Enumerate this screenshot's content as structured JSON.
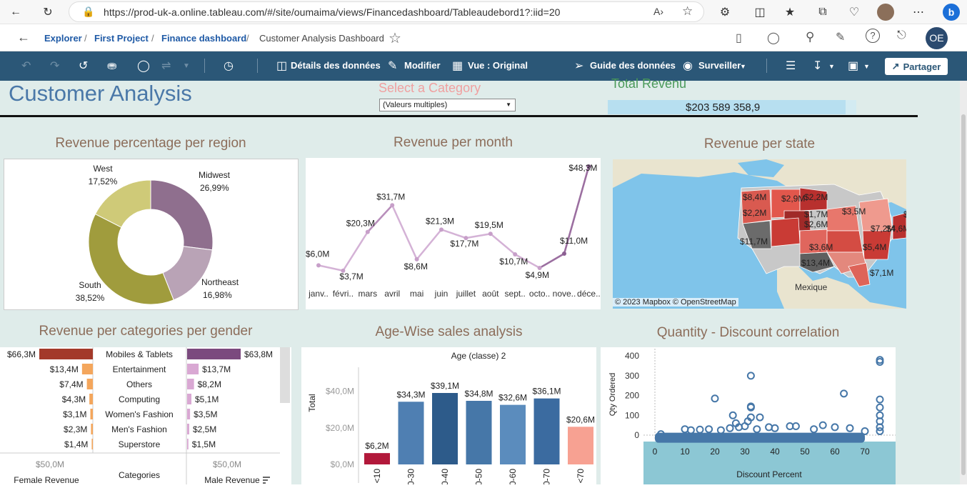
{
  "browser": {
    "url": "https://prod-uk-a.online.tableau.com/#/site/oumaima/views/Financedashboard/Tableaudebord1?:iid=20"
  },
  "breadcrumb": {
    "items": [
      "Explorer",
      "First Project",
      "Finance dashboard"
    ],
    "current": "Customer Analysis Dashboard"
  },
  "user": {
    "initials": "OE"
  },
  "toolbar": {
    "data_details": "Détails des données",
    "modify": "Modifier",
    "view": "Vue : Original",
    "data_guide": "Guide des données",
    "watch": "Surveiller",
    "share": "Partager"
  },
  "dashboard": {
    "title": "Customer Analysis",
    "category_filter": {
      "label": "Select a Category",
      "value": "(Valeurs multiples)"
    },
    "total_revenue": {
      "label": "Total Revenu",
      "value": "$203 589 358,9"
    }
  },
  "colors": {
    "toolbar": "#2b5777",
    "dashboard_bg": "#dfecea",
    "title_blue": "#4a78a8",
    "chart_title": "#8c6d5a",
    "filter_label": "#f0a0a0",
    "revenue_label": "#4a9a5a"
  },
  "region_chart": {
    "title": "Revenue percentage per region",
    "slices": [
      {
        "region": "Midwest",
        "pct": 26.99,
        "label": "26,99%",
        "color": "#8f6f8e"
      },
      {
        "region": "Northeast",
        "pct": 16.98,
        "label": "16,98%",
        "color": "#b9a3b6"
      },
      {
        "region": "South",
        "pct": 38.52,
        "label": "38,52%",
        "color": "#a09c3d"
      },
      {
        "region": "West",
        "pct": 17.52,
        "label": "17,52%",
        "color": "#cfca78"
      }
    ]
  },
  "month_chart": {
    "title": "Revenue per month",
    "months": [
      "janv..",
      "févri..",
      "mars",
      "avril",
      "mai",
      "juin",
      "juillet",
      "août",
      "sept..",
      "octo..",
      "nove..",
      "déce.."
    ],
    "values": [
      6.0,
      3.7,
      20.3,
      31.7,
      8.6,
      21.3,
      17.7,
      19.5,
      10.7,
      4.9,
      11.0,
      48.3
    ],
    "labels": [
      "$6,0M",
      "$3,7M",
      "$20,3M",
      "$31,7M",
      "$8,6M",
      "$21,3M",
      "$17,7M",
      "$19,5M",
      "$10,7M",
      "$4,9M",
      "$11,0M",
      "$48,3M"
    ]
  },
  "state_map": {
    "title": "Revenue per state",
    "labels": [
      "$8,4M",
      "$2,9M",
      "$2,2M",
      "$2,2M",
      "$1,7M",
      "$3,5M",
      "$2,6M",
      "$7,2M",
      "$4,6M",
      "$1,1",
      "$11,7M",
      "$3,6M",
      "$13,4M",
      "$5,4M",
      "$7,1M"
    ],
    "country_label": "Mexique",
    "attribution": "© 2023 Mapbox  © OpenStreetMap"
  },
  "gender_chart": {
    "title": "Revenue per categories per gender",
    "categories": [
      "Mobiles & Tablets",
      "Entertainment",
      "Others",
      "Computing",
      "Women's Fashion",
      "Men's Fashion",
      "Superstore"
    ],
    "female": [
      66.3,
      13.4,
      7.4,
      4.3,
      3.1,
      2.3,
      1.4
    ],
    "female_labels": [
      "$66,3M",
      "$13,4M",
      "$7,4M",
      "$4,3M",
      "$3,1M",
      "$2,3M",
      "$1,4M"
    ],
    "male": [
      63.8,
      13.7,
      8.2,
      5.1,
      3.5,
      2.5,
      1.5
    ],
    "male_labels": [
      "$63,8M",
      "$13,7M",
      "$8,2M",
      "$5,1M",
      "$3,5M",
      "$2,5M",
      "$1,5M"
    ],
    "female_axis_tick": "$50,0M",
    "male_axis_tick": "$50,0M",
    "female_axis_title": "Female Revenue",
    "category_axis_title": "Categories",
    "male_axis_title": "Male Revenue"
  },
  "age_chart": {
    "title": "Age-Wise sales analysis",
    "header": "Age (classe) 2",
    "ylabel": "Total",
    "ticks": [
      "$0,0M",
      "$20,0M",
      "$40,0M"
    ],
    "categories": [
      "<10",
      "20-30",
      "30-40",
      "40-50",
      "50-60",
      "60-70",
      "<70"
    ],
    "values": [
      6.2,
      34.3,
      39.1,
      34.8,
      32.6,
      36.1,
      20.6
    ],
    "labels": [
      "$6,2M",
      "$34,3M",
      "$39,1M",
      "$34,8M",
      "$32,6M",
      "$36,1M",
      "$20,6M"
    ],
    "colors": [
      "#b2183a",
      "#4f7fb2",
      "#2d5b8a",
      "#4677a8",
      "#5b8cbd",
      "#3b6ba0",
      "#f7a192"
    ]
  },
  "scatter_chart": {
    "title": "Quantity - Discount correlation",
    "xlabel": "Discount Percent",
    "ylabel": "Qty Ordered",
    "xticks": [
      "0",
      "10",
      "20",
      "30",
      "40",
      "50",
      "60",
      "70"
    ],
    "yticks": [
      "0",
      "100",
      "200",
      "300",
      "400"
    ]
  }
}
